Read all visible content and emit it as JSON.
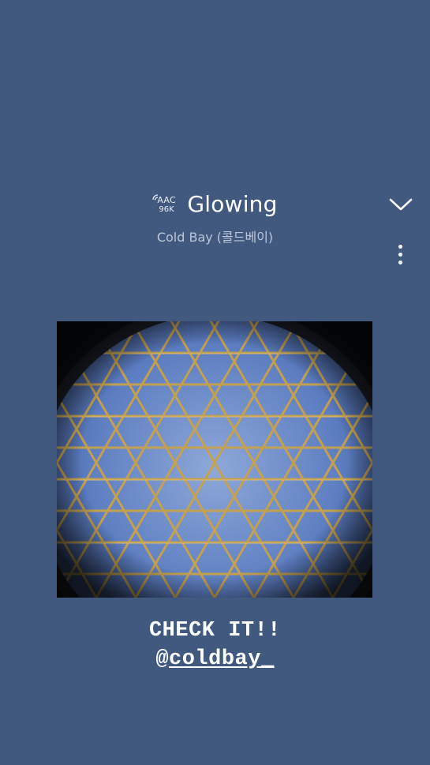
{
  "now_playing": {
    "quality_format": "AAC",
    "quality_bitrate": "96K",
    "title": "Glowing",
    "artist": "Cold Bay (콜드베이)"
  },
  "controls": {
    "collapse_icon": "chevron-down-icon",
    "more_icon": "more-vertical-icon"
  },
  "album_art": {
    "description_icon": "album-art-image"
  },
  "caption": {
    "line1": "CHECK IT!!",
    "at_sign": "@",
    "mention": "coldbay_"
  },
  "colors": {
    "background": "#41597f",
    "text": "#ffffff",
    "artist_text": "#bcc6d8"
  }
}
